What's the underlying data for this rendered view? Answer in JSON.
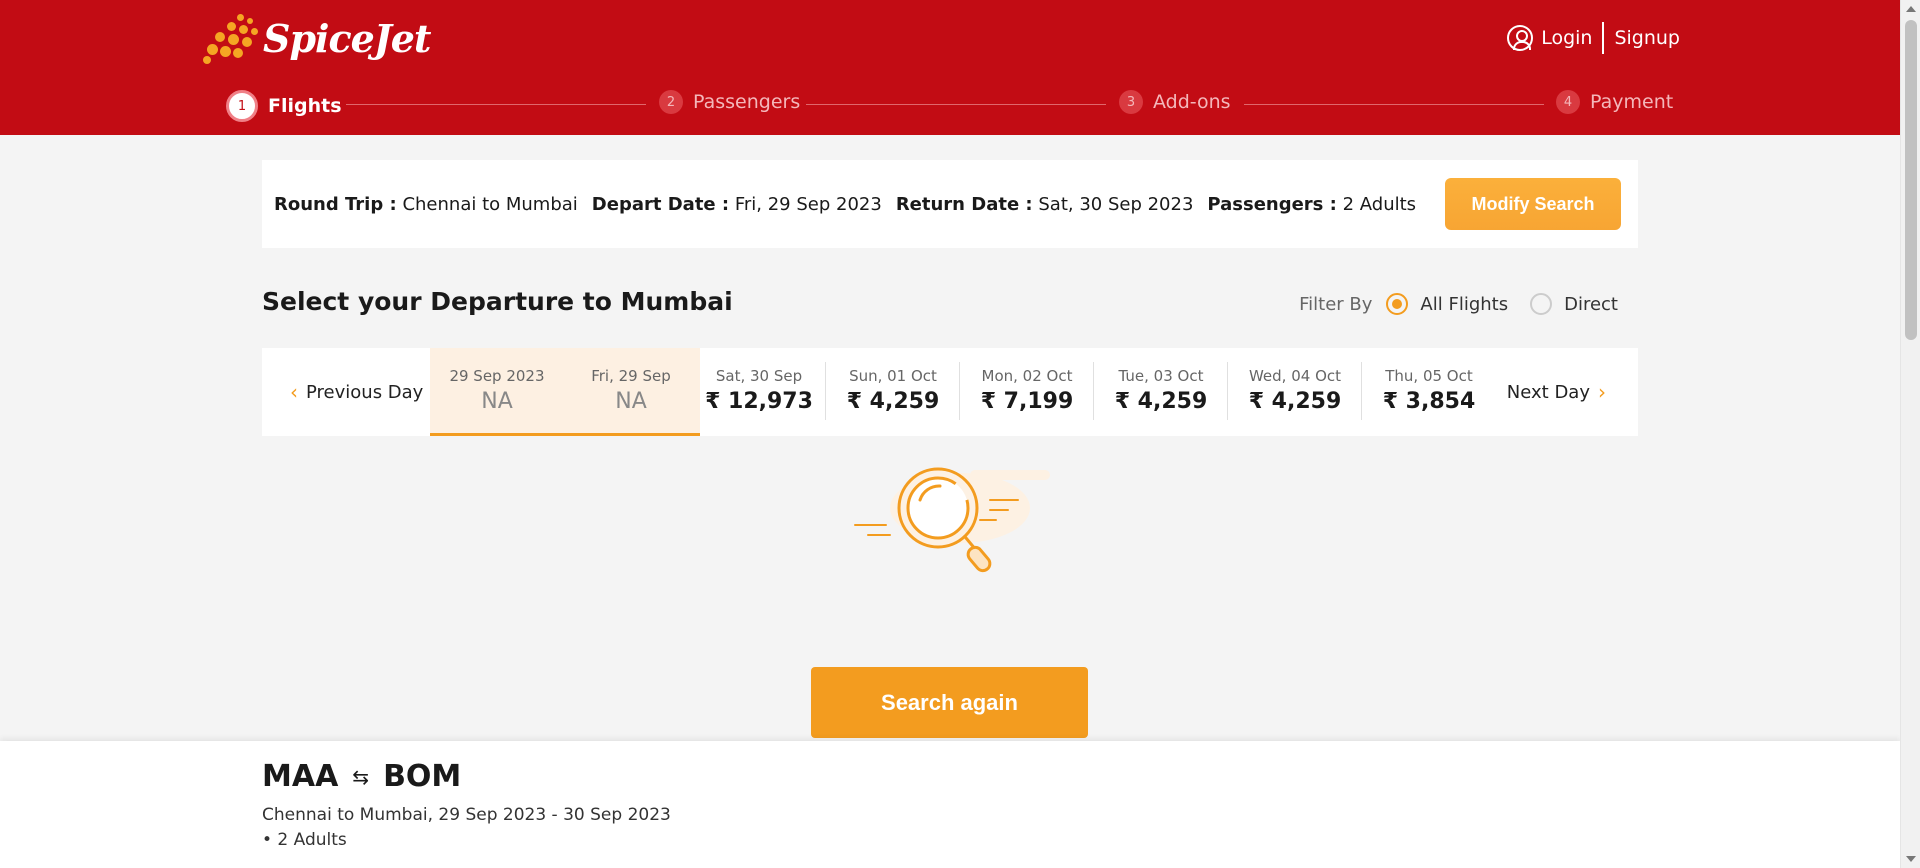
{
  "brand": {
    "name": "SpiceJet",
    "primary_color": "#c20c14",
    "accent_color": "#f39c1f"
  },
  "auth": {
    "login": "Login",
    "signup": "Signup"
  },
  "steps": [
    {
      "num": "1",
      "label": "Flights",
      "active": true
    },
    {
      "num": "2",
      "label": "Passengers",
      "active": false
    },
    {
      "num": "3",
      "label": "Add-ons",
      "active": false
    },
    {
      "num": "4",
      "label": "Payment",
      "active": false
    }
  ],
  "summary": {
    "trip_label": "Round Trip :",
    "trip_value": "Chennai to Mumbai",
    "depart_label": "Depart Date :",
    "depart_value": "Fri, 29 Sep 2023",
    "return_label": "Return Date :",
    "return_value": "Sat, 30 Sep 2023",
    "pax_label": "Passengers :",
    "pax_value": "2 Adults",
    "modify_button": "Modify Search"
  },
  "selection": {
    "title": "Select your Departure to Mumbai",
    "filter_label": "Filter By",
    "filter_options": [
      "All Flights",
      "Direct"
    ],
    "filter_selected": "All Flights"
  },
  "date_strip": {
    "prev": "Previous Day",
    "next": "Next Day",
    "dates": [
      {
        "label": "29 Sep 2023",
        "price": "NA"
      },
      {
        "label": "Fri, 29 Sep",
        "price": "NA"
      },
      {
        "label": "Sat, 30 Sep",
        "price": "₹ 12,973"
      },
      {
        "label": "Sun, 01 Oct",
        "price": "₹ 4,259"
      },
      {
        "label": "Mon, 02 Oct",
        "price": "₹ 7,199"
      },
      {
        "label": "Tue, 03 Oct",
        "price": "₹ 4,259"
      },
      {
        "label": "Wed, 04 Oct",
        "price": "₹ 4,259"
      },
      {
        "label": "Thu, 05 Oct",
        "price": "₹ 3,854"
      }
    ]
  },
  "no_results": {
    "illustration": "search-magnifier-icon",
    "button": "Search again"
  },
  "bottom": {
    "origin": "MAA",
    "destination": "BOM",
    "swap_icon": "⇆",
    "subtitle": "Chennai to Mumbai, 29 Sep 2023 - 30 Sep 2023",
    "passengers": "• 2 Adults"
  }
}
